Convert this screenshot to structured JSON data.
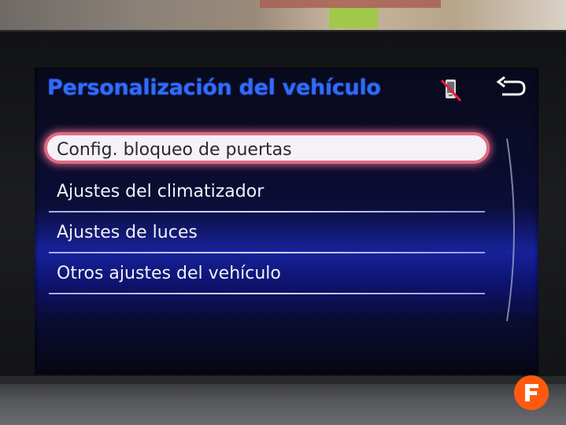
{
  "header": {
    "title": "Personalización del vehículo",
    "icons": [
      "phone-disconnected-icon",
      "back-arrow-icon"
    ]
  },
  "menu": {
    "items": [
      {
        "label": "Config. bloqueo de puertas",
        "selected": true
      },
      {
        "label": "Ajustes del climatizador",
        "selected": false
      },
      {
        "label": "Ajustes de luces",
        "selected": false
      },
      {
        "label": "Otros ajustes del vehículo",
        "selected": false
      }
    ]
  },
  "colors": {
    "title": "#2f6bff",
    "selection_border": "#e06a82",
    "selection_fill": "#f5f1f6",
    "logo": "#ff5a10"
  }
}
